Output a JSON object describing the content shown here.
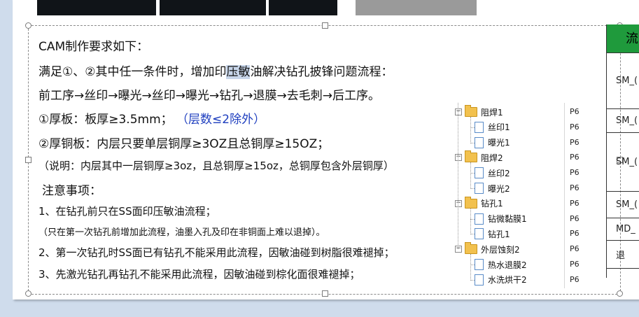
{
  "slide": {
    "heading": "CAM制作要求如下：",
    "line1_pre": "满足①、②其中任一条件时，增加印",
    "line1_hl": "压敏",
    "line1_post": "油解决钻孔披锋问题流程：",
    "line2": "前工序→丝印→曝光→丝印→曝光→钻孔→退膜→去毛刺→后工序。",
    "line3_main": "①厚板：板厚≥3.5mm；",
    "line3_blue": "（层数≤2除外）",
    "line4": "②厚铜板：内层只要单层铜厚≥3OZ且总铜厚≥15OZ；",
    "line5": "（说明：内层其中一层铜厚≥3oz，且总铜厚≥15oz，总铜厚包含外层铜厚）",
    "notes_title": "注意事项：",
    "note1": "1、在钻孔前只在SS面印压敏油流程；",
    "note1_sub": "（只在第一次钻孔前增加此流程，油墨入孔及印在非铜面上难以退掉）。",
    "note2": "2、第一次钻孔时SS面已有钻孔不能采用此流程，因敏油碰到树脂很难褪掉；",
    "note3": "3、先激光钻孔再钻孔不能采用此流程，因敏油碰到棕化面很难褪掉；"
  },
  "tree": {
    "items": [
      {
        "kind": "folder",
        "label": "阻焊1",
        "p": "P6"
      },
      {
        "kind": "doc",
        "label": "丝印1",
        "p": "P6"
      },
      {
        "kind": "doc",
        "label": "曝光1",
        "p": "P6"
      },
      {
        "kind": "folder",
        "label": "阻焊2",
        "p": "P6"
      },
      {
        "kind": "doc",
        "label": "丝印2",
        "p": "P6"
      },
      {
        "kind": "doc",
        "label": "曝光2",
        "p": "P6"
      },
      {
        "kind": "folder",
        "label": "钻孔1",
        "p": "P6"
      },
      {
        "kind": "doc",
        "label": "钻微黏膜1",
        "p": "P6"
      },
      {
        "kind": "doc",
        "label": "钻孔1",
        "p": "P6"
      },
      {
        "kind": "folder",
        "label": "外层蚀刻2",
        "p": "P6"
      },
      {
        "kind": "doc",
        "label": "热水退膜2",
        "p": "P6"
      },
      {
        "kind": "doc",
        "label": "水洗烘干2",
        "p": "P6"
      }
    ],
    "expander_glyph": "−"
  },
  "table": {
    "header": "流",
    "rows": [
      "SM_(",
      "SM_(",
      "SM_(",
      "SM_(",
      "MD_",
      "退"
    ]
  },
  "colors": {
    "table_header": "#1f9a3c",
    "blue_text": "#1f3fbf",
    "highlight": "#c8d6ea"
  }
}
